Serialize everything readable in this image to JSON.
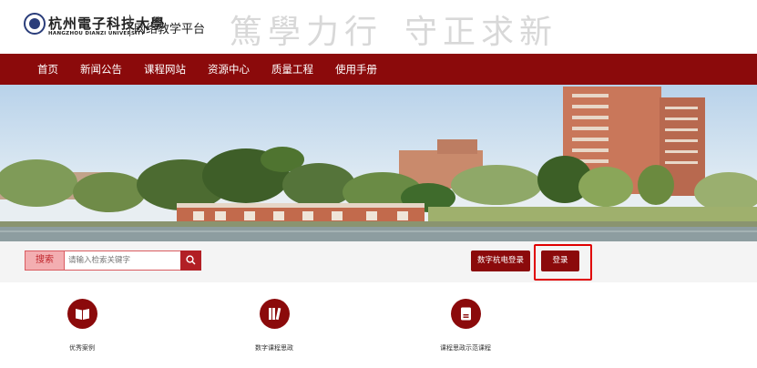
{
  "header": {
    "logo_cn": "杭州電子科技大學",
    "logo_en": "HANGZHOU DIANZI UNIVERSITY",
    "platform_name": "网络教学平台",
    "slogan_part1": "篤學力行",
    "slogan_part2": "守正求新"
  },
  "nav": {
    "items": [
      "首页",
      "新闻公告",
      "课程网站",
      "资源中心",
      "质量工程",
      "使用手册"
    ]
  },
  "search": {
    "label": "搜索",
    "placeholder": "请输入检索关键字",
    "button_icon": "search-icon"
  },
  "buttons": {
    "digital_login": "数字杭电登录",
    "login": "登录"
  },
  "features": [
    {
      "label": "优秀案例",
      "icon": "book-icon"
    },
    {
      "label": "数字课程思政",
      "icon": "books-icon"
    },
    {
      "label": "课程思政示范课程",
      "icon": "document-icon"
    }
  ],
  "colors": {
    "brand": "#8b0a0b",
    "highlight": "#e00000"
  }
}
